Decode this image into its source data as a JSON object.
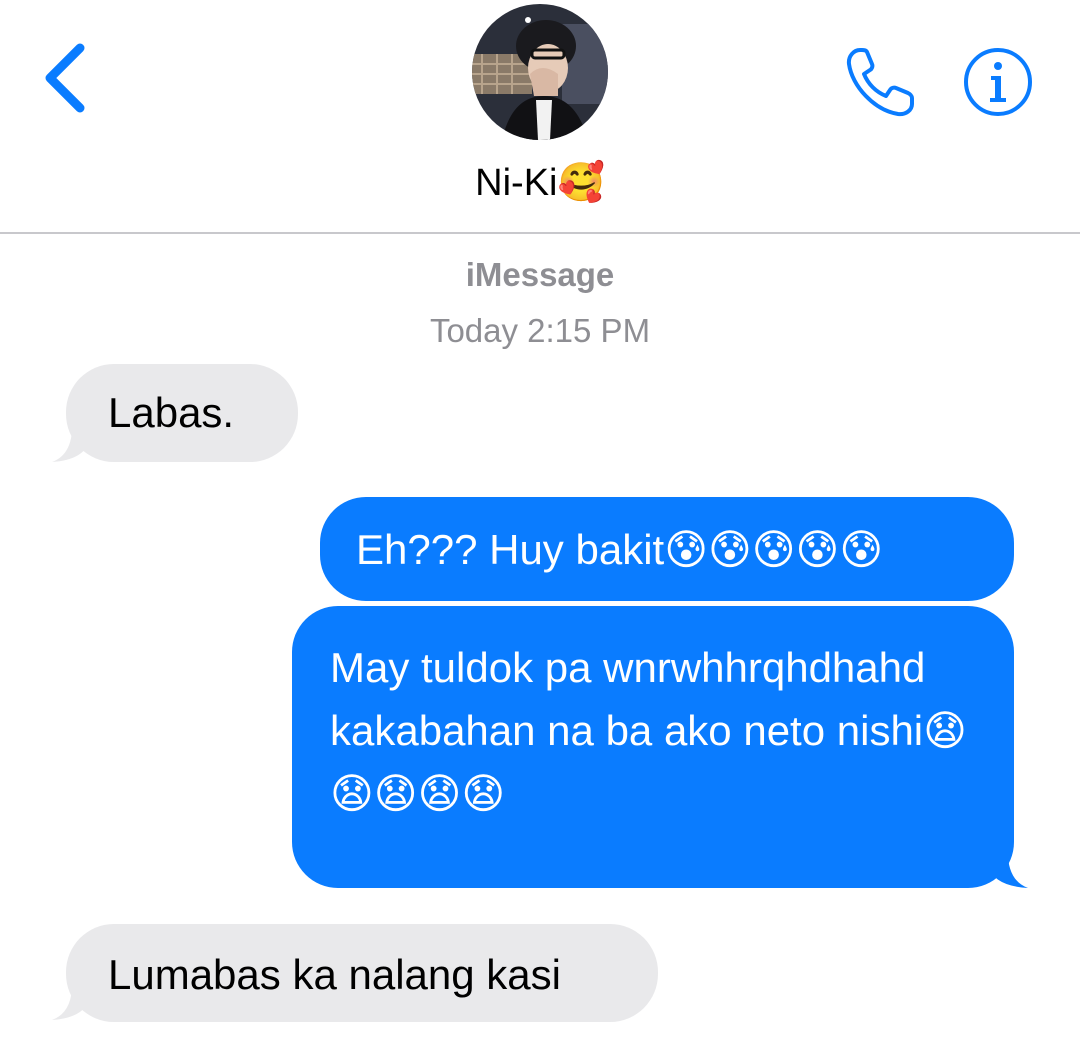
{
  "header": {
    "contact_name": "Ni-Ki🥰",
    "back_icon": "chevron-left-icon",
    "call_icon": "phone-icon",
    "info_icon": "info-icon",
    "accent_color": "#0a7cff"
  },
  "thread": {
    "service": "iMessage",
    "timestamp": "Today 2:15 PM"
  },
  "messages": [
    {
      "direction": "incoming",
      "text": "Labas."
    },
    {
      "direction": "outgoing",
      "text": "Eh??? Huy bakit😰😰😰😰😰"
    },
    {
      "direction": "outgoing",
      "text": "May tuldok pa wnrwhhrqhdhahd kakabahan na ba ako neto nishi😧😧😧😧😧"
    },
    {
      "direction": "incoming",
      "text": "Lumabas ka nalang kasi"
    }
  ],
  "colors": {
    "incoming_bubble": "#e9e9eb",
    "outgoing_bubble": "#0a7cff",
    "meta_text": "#8e8e93"
  }
}
